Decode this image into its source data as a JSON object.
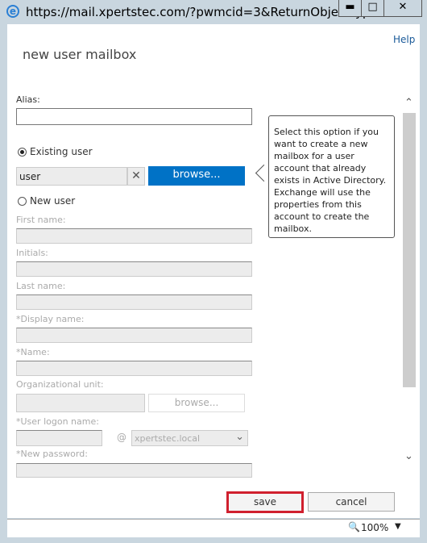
{
  "window": {
    "title": "https://mail.xpertstec.com/?pwmcid=3&ReturnObjectType...",
    "minimize": "▬",
    "maximize": "□",
    "close": "✕"
  },
  "dialog": {
    "help": "Help",
    "heading": "new user mailbox"
  },
  "form": {
    "alias_label": "Alias:",
    "alias_value": "",
    "existing_user_label": "Existing user",
    "existing_user_selected": true,
    "user_value": "user",
    "clear_icon": "✕",
    "browse_label": "browse...",
    "new_user_label": "New user",
    "first_name_label": "First name:",
    "initials_label": "Initials:",
    "last_name_label": "Last name:",
    "display_name_label": "*Display name:",
    "name_label": "*Name:",
    "ou_label": "Organizational unit:",
    "ou_browse_label": "browse...",
    "logon_label": "*User logon name:",
    "at": "@",
    "domain_value": "xpertstec.local",
    "password_label": "*New password:"
  },
  "tooltip": "Select this option if you want to create a new mailbox for a user account that already exists in Active Directory. Exchange will use the properties from this account to create the mailbox.",
  "buttons": {
    "save": "save",
    "cancel": "cancel"
  },
  "status": {
    "zoom": "100%"
  },
  "colors": {
    "accent": "#0072c6",
    "highlight": "#d0202e"
  }
}
